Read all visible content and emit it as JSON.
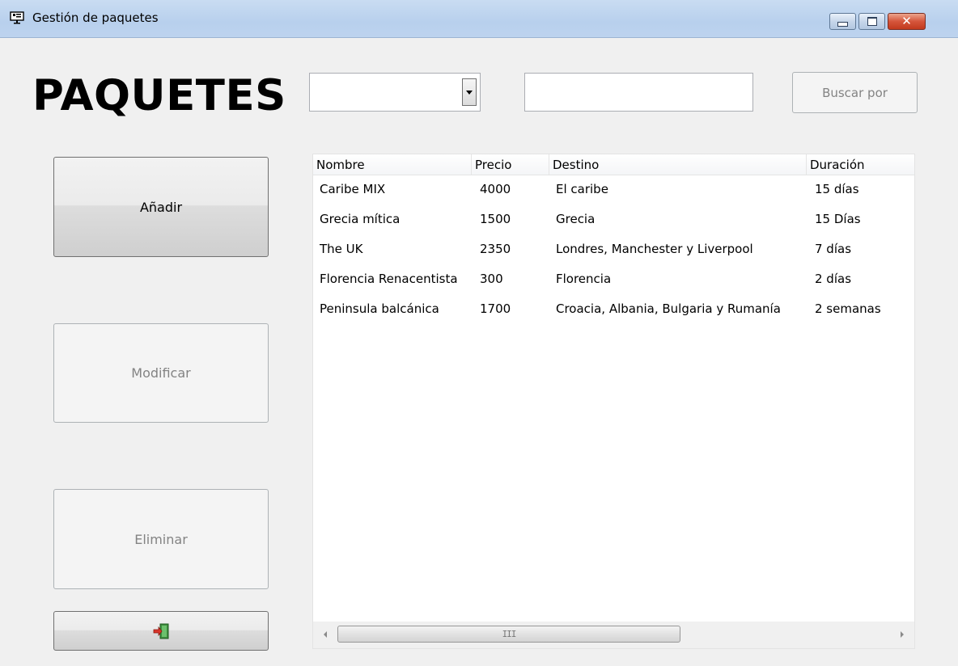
{
  "window": {
    "title": "Gestión de paquetes",
    "close_glyph": "✕"
  },
  "header": {
    "title": "PAQUETES"
  },
  "search": {
    "field_selected": "",
    "query_value": "",
    "button_label": "Buscar por"
  },
  "actions": {
    "add_label": "Añadir",
    "modify_label": "Modificar",
    "delete_label": "Eliminar",
    "exit_icon": "exit-door-icon"
  },
  "table": {
    "columns": [
      "Nombre",
      "Precio",
      "Destino",
      "Duración"
    ],
    "rows": [
      [
        "Caribe MIX",
        "4000",
        "El caribe",
        "15 días"
      ],
      [
        "Grecia mítica",
        "1500",
        "Grecia",
        "15 Días"
      ],
      [
        "The UK",
        "2350",
        "Londres, Manchester y Liverpool",
        "7 días"
      ],
      [
        "Florencia Renacentista",
        "300",
        "Florencia",
        "2 días"
      ],
      [
        "Peninsula balcánica",
        "1700",
        "Croacia, Albania, Bulgaria y Rumanía",
        "2 semanas"
      ]
    ]
  },
  "scrollbar": {
    "grip": "III"
  },
  "colors": {
    "titlebar": "#bdd3ee",
    "close_button": "#c23a1e",
    "disabled_text": "#838383"
  }
}
